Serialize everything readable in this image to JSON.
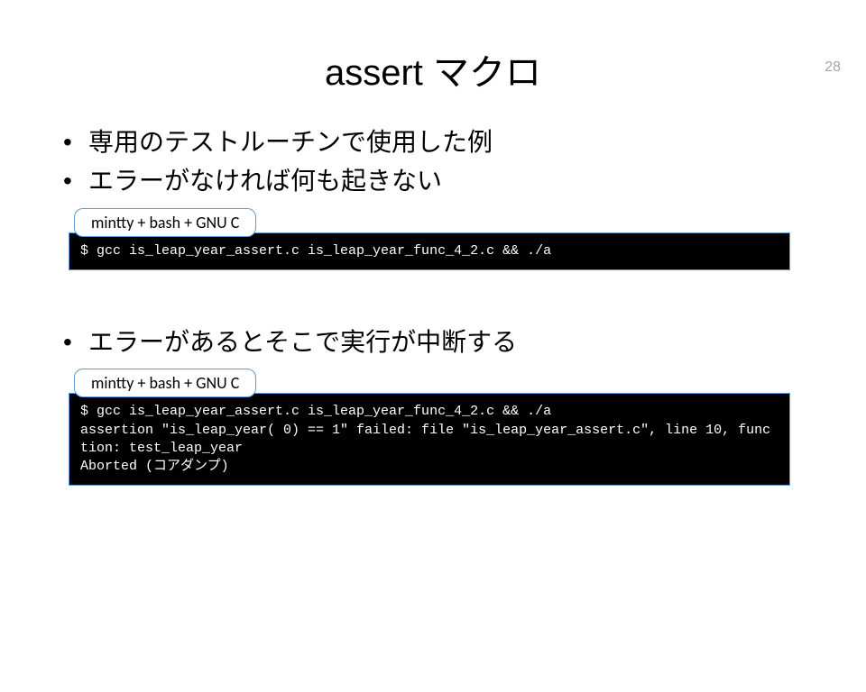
{
  "page_number": "28",
  "title": "assert マクロ",
  "bullets_top": [
    "専用のテストルーチンで使用した例",
    "エラーがなければ何も起きない"
  ],
  "bullets_bottom": [
    "エラーがあるとそこで実行が中断する"
  ],
  "terminal1": {
    "label": "mintty + bash + GNU C",
    "content": "$ gcc is_leap_year_assert.c is_leap_year_func_4_2.c && ./a"
  },
  "terminal2": {
    "label": "mintty + bash + GNU C",
    "content": "$ gcc is_leap_year_assert.c is_leap_year_func_4_2.c && ./a\nassertion \"is_leap_year( 0) == 1\" failed: file \"is_leap_year_assert.c\", line 10, function: test_leap_year\nAborted (コアダンプ)"
  }
}
